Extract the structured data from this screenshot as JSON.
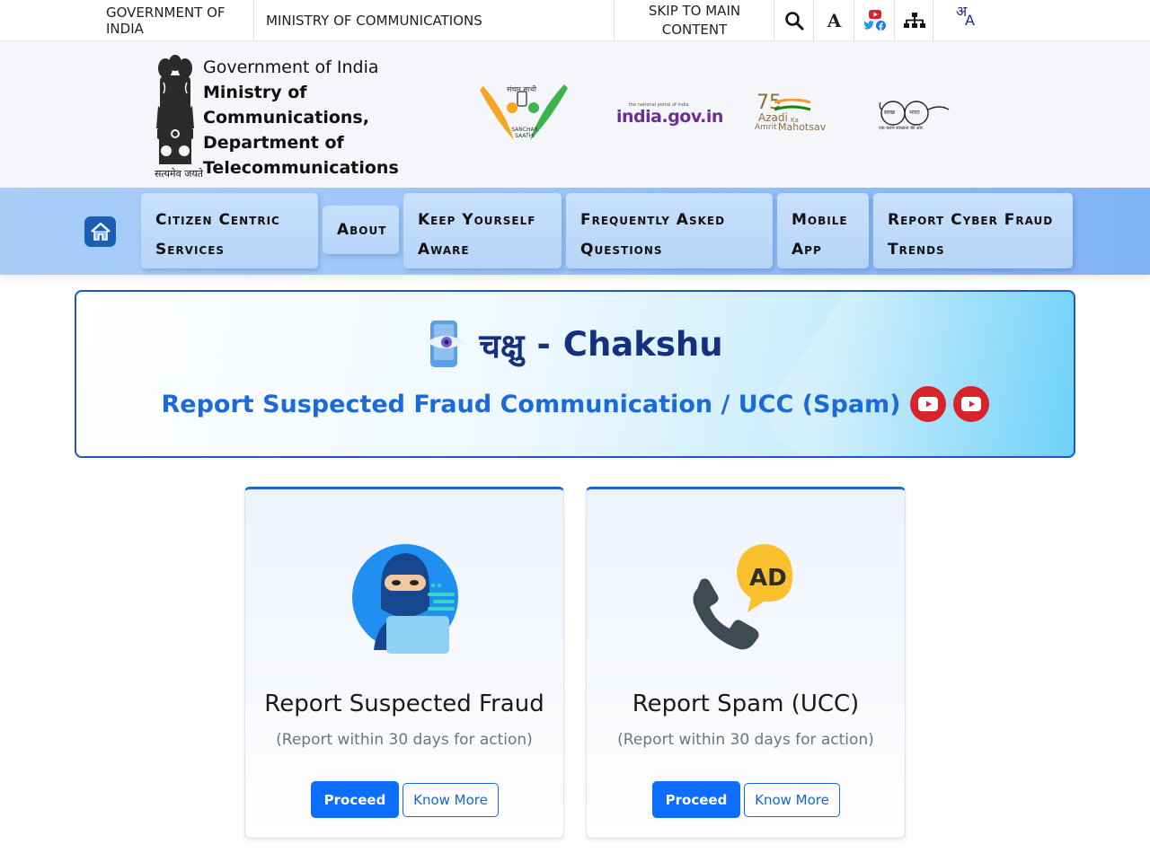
{
  "topbar": {
    "government": "GOVERNMENT OF INDIA",
    "ministry": "MINISTRY OF COMMUNICATIONS",
    "skip": "SKIP TO MAIN CONTENT",
    "font_size_glyph": "A",
    "lang_hi": "अ",
    "lang_en": "A",
    "icons": [
      "search-icon",
      "font-size-icon",
      "youtube-icon",
      "twitter-icon",
      "facebook-icon",
      "sitemap-icon",
      "language-icon"
    ]
  },
  "header": {
    "org_top": "Government of India",
    "org_lines": [
      "Ministry of",
      "Communications,",
      "Department of",
      "Telecommunications"
    ],
    "emblem_caption": "सत्यमेव जयते",
    "partners": {
      "sanchar_saathi": "SANCHAR SAATHI",
      "sanchar_saathi_hi": "संचार साथी",
      "india_gov": "india.gov.in",
      "india_gov_tag": "the national portal of india",
      "azadi_75": "75",
      "azadi": "Azadi",
      "azadi_ka": "Ka",
      "amrit": "Amrit",
      "mahotsav": "Mahotsav",
      "swachh": "स्वच्छ",
      "bharat": "भारत",
      "swachh_tag": "एक कदम स्वच्छता की ओर"
    }
  },
  "nav": {
    "items": [
      {
        "line1": "Citizen Centric",
        "line2": "Services"
      },
      {
        "line1": "About",
        "line2": ""
      },
      {
        "line1": "Keep Yourself",
        "line2": "Aware"
      },
      {
        "line1": "Frequently Asked",
        "line2": "Questions"
      },
      {
        "line1": "Mobile",
        "line2": "App"
      },
      {
        "line1": "Report Cyber Fraud",
        "line2": "Trends"
      }
    ]
  },
  "banner": {
    "title_hi": "चक्षु",
    "title_sep": "-",
    "title_en": "Chakshu",
    "subtitle": "Report Suspected Fraud Communication / UCC (Spam)"
  },
  "cards": [
    {
      "title": "Report Suspected Fraud",
      "subtitle": "(Report within 30 days for action)",
      "proceed": "Proceed",
      "know_more": "Know More",
      "icon": "hacker-icon"
    },
    {
      "title": "Report Spam (UCC)",
      "subtitle": "(Report within 30 days for action)",
      "proceed": "Proceed",
      "know_more": "Know More",
      "icon": "phone-ad-icon"
    }
  ],
  "colors": {
    "nav_bg": "#9ec7fa",
    "banner_border": "#1f57c9",
    "banner_title": "#14307e",
    "banner_subtitle": "#1a6ad8",
    "primary_button": "#0d6efd",
    "youtube_red": "#d9232b"
  }
}
